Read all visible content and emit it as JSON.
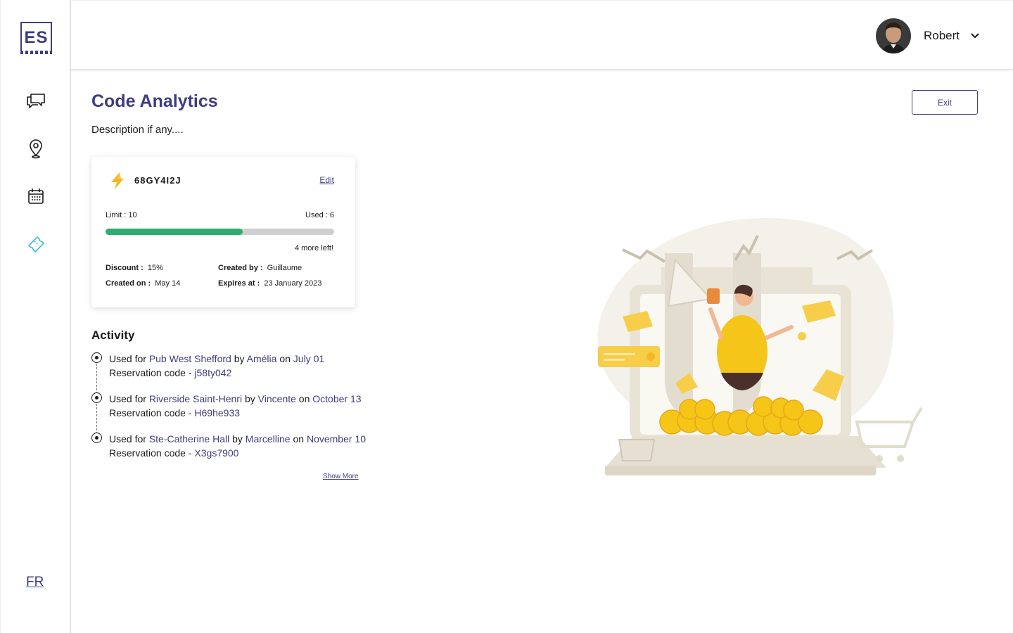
{
  "sidebar": {
    "logo": "ES",
    "items": [
      {
        "icon": "chat-icon"
      },
      {
        "icon": "location-pin-icon"
      },
      {
        "icon": "calendar-icon"
      },
      {
        "icon": "ticket-icon",
        "active": true
      }
    ],
    "language": "FR",
    "active_color": "#3fc1c9"
  },
  "header": {
    "user_name": "Robert"
  },
  "page": {
    "title": "Code Analytics",
    "description": "Description if any....",
    "exit_label": "Exit"
  },
  "code_card": {
    "code": "68GY4I2J",
    "edit_label": "Edit",
    "limit_text": "Limit : 10",
    "used_text": "Used : 6",
    "usage_fraction": 0.6,
    "remaining_text": "4 more left!",
    "discount_label": "Discount :",
    "discount_value": "15%",
    "created_by_label": "Created by :",
    "created_by_value": "Guillaume",
    "created_on_label": "Created on :",
    "created_on_value": "May 14",
    "expires_label": "Expires at :",
    "expires_value": "23 January 2023",
    "progress_color": "#2fac6f"
  },
  "activity": {
    "title": "Activity",
    "items": [
      {
        "used_for": "Used for",
        "place": "Pub West Shefford",
        "by": "by",
        "person": "Amélia",
        "on_text": "on",
        "date": "July 01",
        "res_label": "Reservation code -",
        "res_code": "j58ty042"
      },
      {
        "used_for": "Used for",
        "place": "Riverside Saint-Henri",
        "by": "by",
        "person": "Vincente",
        "on_text": "on",
        "date": "October 13",
        "res_label": "Reservation code -",
        "res_code": "H69he933"
      },
      {
        "used_for": "Used for",
        "place": "Ste-Catherine Hall",
        "by": "by",
        "person": "Marcelline",
        "on_text": "on",
        "date": "November 10",
        "res_label": "Reservation code -",
        "res_code": "X3gs7900"
      }
    ],
    "show_more": "Show More"
  },
  "colors": {
    "primary": "#3d3d82",
    "accent_yellow": "#f5c518"
  }
}
